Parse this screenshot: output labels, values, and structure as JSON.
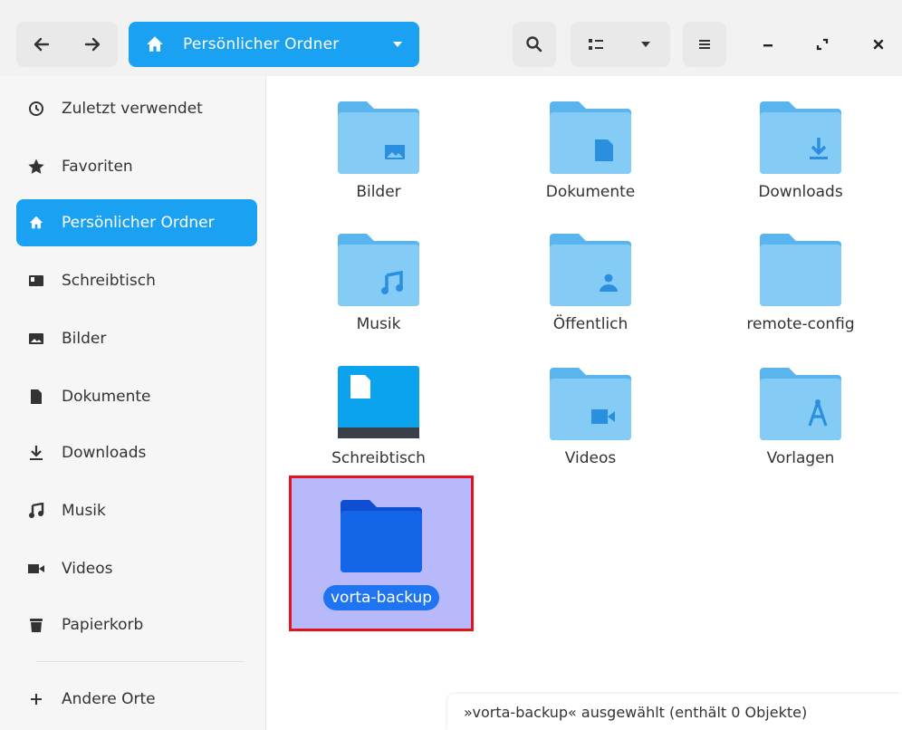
{
  "header": {
    "location_label": "Persönlicher Ordner",
    "buttons": {
      "back": "arrow-left-icon",
      "forward": "arrow-right-icon",
      "search": "search-icon",
      "view_toggle": "grid-view-icon",
      "view_options": "chevron-down-icon",
      "menu": "hamburger-menu-icon",
      "minimize": "minimize-icon",
      "maximize": "maximize-icon",
      "close": "close-icon"
    }
  },
  "sidebar": {
    "items": [
      {
        "label": "Zuletzt verwendet",
        "icon": "clock-icon"
      },
      {
        "label": "Favoriten",
        "icon": "star-icon"
      },
      {
        "label": "Persönlicher Ordner",
        "icon": "home-icon",
        "active": true
      },
      {
        "label": "Schreibtisch",
        "icon": "desktop-icon"
      },
      {
        "label": "Bilder",
        "icon": "image-icon"
      },
      {
        "label": "Dokumente",
        "icon": "document-icon"
      },
      {
        "label": "Downloads",
        "icon": "download-icon"
      },
      {
        "label": "Musik",
        "icon": "music-icon"
      },
      {
        "label": "Videos",
        "icon": "video-icon"
      },
      {
        "label": "Papierkorb",
        "icon": "trash-icon"
      },
      {
        "label": "Andere Orte",
        "icon": "plus-icon"
      }
    ]
  },
  "files": [
    {
      "name": "Bilder",
      "emblem": "image"
    },
    {
      "name": "Dokumente",
      "emblem": "document"
    },
    {
      "name": "Downloads",
      "emblem": "download"
    },
    {
      "name": "Musik",
      "emblem": "music"
    },
    {
      "name": "Öffentlich",
      "emblem": "person"
    },
    {
      "name": "remote-config",
      "emblem": "none"
    },
    {
      "name": "Schreibtisch",
      "emblem": "desktop"
    },
    {
      "name": "Videos",
      "emblem": "video"
    },
    {
      "name": "Vorlagen",
      "emblem": "template"
    },
    {
      "name": "vorta-backup",
      "emblem": "none",
      "selected": true
    }
  ],
  "status": {
    "text": "»vorta-backup« ausgewählt  (enthält 0 Objekte)"
  },
  "colors": {
    "accent": "#1ba1f2",
    "folder": "#84ccf6",
    "folder_tab": "#5ab5ef",
    "selection_bg": "#b8b9fb",
    "selection_outline": "#e5121e",
    "selected_folder": "#1565e8"
  }
}
